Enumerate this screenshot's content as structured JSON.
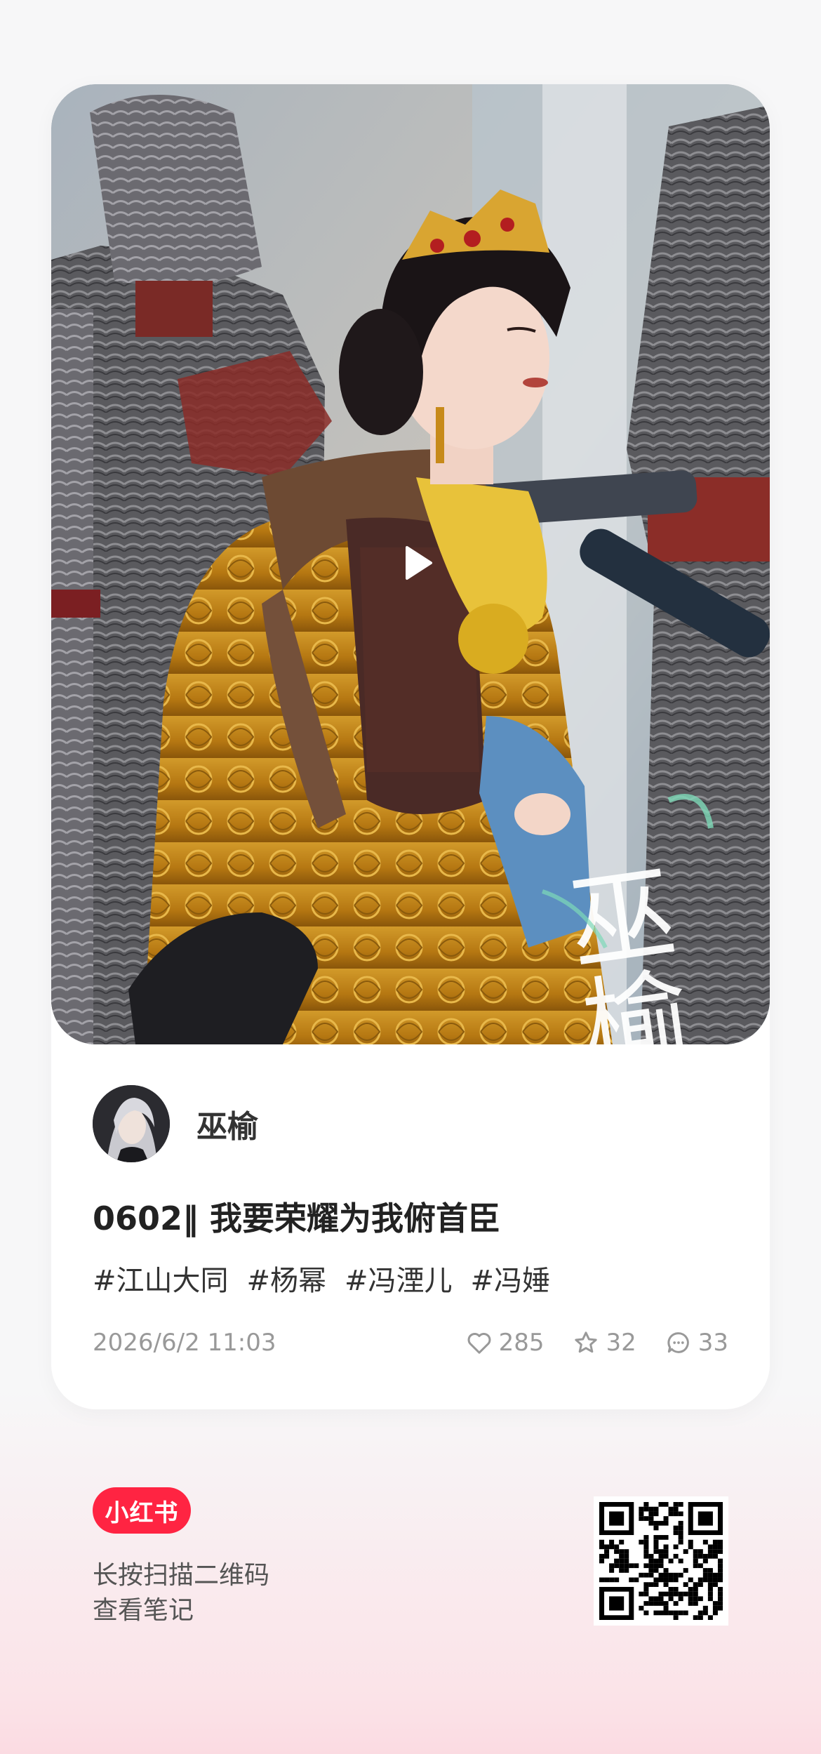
{
  "post": {
    "author_name": "巫榆",
    "title": "0602‖ 我要荣耀为我俯首臣",
    "tags": [
      "#江山大同",
      "#杨幂",
      "#冯湮儿",
      "#冯娷"
    ],
    "date": "2026/6/2 11:03",
    "likes": "285",
    "favorites": "32",
    "comments": "33",
    "watermark_text": "巫榆"
  },
  "footer": {
    "brand_logo": "小红书",
    "scan_hint_line1": "长按扫描二维码",
    "scan_hint_line2": "查看笔记"
  },
  "icons": {
    "play": "play-icon",
    "like": "heart-icon",
    "favorite": "star-icon",
    "comment": "comment-icon"
  },
  "colors": {
    "brand": "#ff2442",
    "text_primary": "#222222",
    "text_secondary": "#999999"
  }
}
